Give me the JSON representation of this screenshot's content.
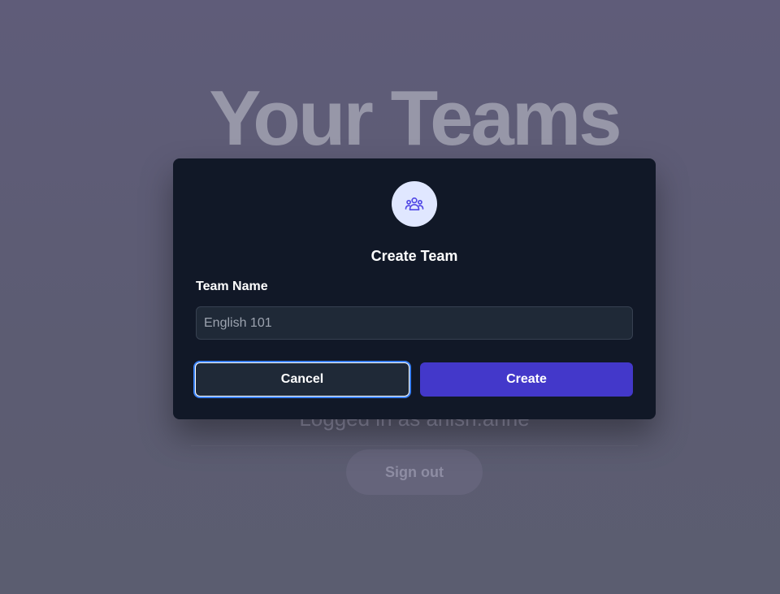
{
  "background": {
    "title": "Your Teams",
    "logged_in_text": "Logged in as anish.anne",
    "signout_label": "Sign out"
  },
  "modal": {
    "icon": "user-group-icon",
    "title": "Create Team",
    "field_label": "Team Name",
    "field_value": "",
    "field_placeholder": "English 101",
    "cancel_label": "Cancel",
    "create_label": "Create"
  },
  "colors": {
    "modal_bg": "#111827",
    "accent": "#4338ca",
    "icon_circle": "#e0e7ff",
    "icon_stroke": "#4f46e5",
    "focus_ring": "#3b82f6"
  }
}
